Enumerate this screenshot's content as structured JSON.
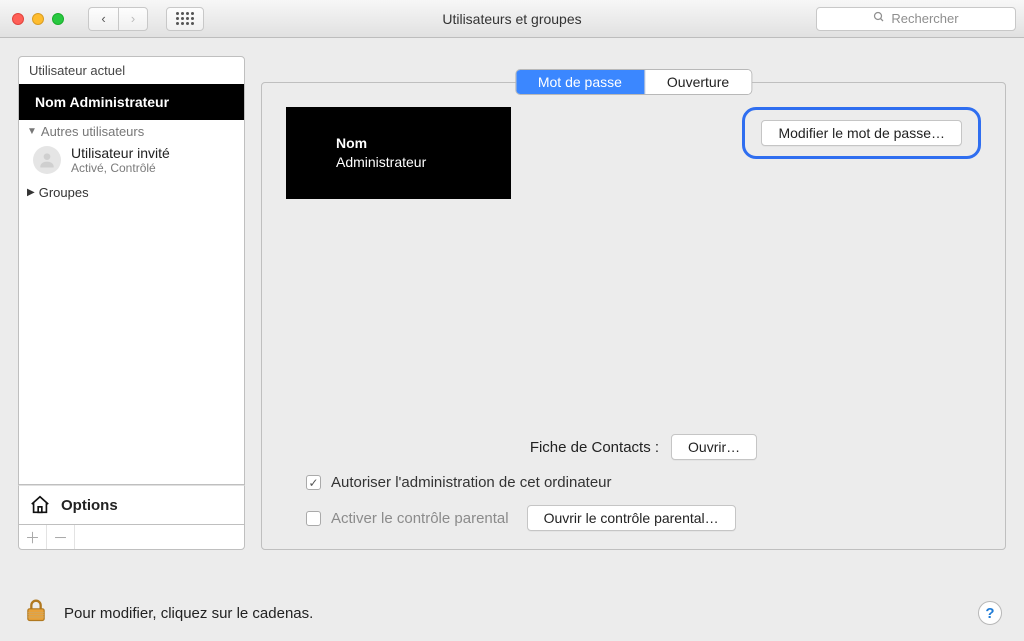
{
  "window": {
    "title": "Utilisateurs et groupes",
    "search_placeholder": "Rechercher"
  },
  "sidebar": {
    "current_user_label": "Utilisateur actuel",
    "selected_user_name": "Nom Administrateur",
    "other_users_label": "Autres utilisateurs",
    "guest": {
      "name": "Utilisateur invité",
      "status": "Activé, Contrôlé"
    },
    "groups_label": "Groupes",
    "options_label": "Options"
  },
  "tabs": {
    "password": "Mot de passe",
    "login": "Ouverture"
  },
  "profile": {
    "line1": "Nom",
    "line2": "Administrateur"
  },
  "buttons": {
    "change_password": "Modifier le mot de passe…",
    "open_contacts": "Ouvrir…",
    "open_parental": "Ouvrir le contrôle parental…"
  },
  "labels": {
    "contacts_card": "Fiche de Contacts :",
    "allow_admin": "Autoriser l'administration de cet ordinateur",
    "enable_parental": "Activer le contrôle parental"
  },
  "footer": {
    "lock_hint": "Pour modifier, cliquez sur le cadenas."
  }
}
